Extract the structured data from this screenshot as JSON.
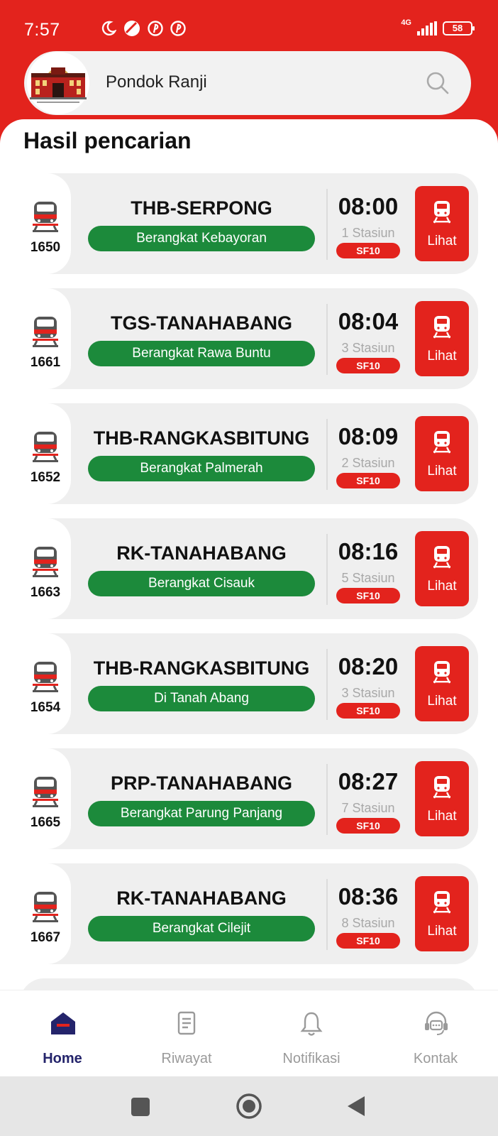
{
  "status_bar": {
    "time": "7:57",
    "network": "4G",
    "battery": "58",
    "left_icons": [
      "moon-icon",
      "ball-icon",
      "pinterest-icon",
      "pinterest-icon"
    ]
  },
  "search": {
    "value": "Pondok Ranji",
    "icon": "search-icon"
  },
  "results": {
    "title": "Hasil pencarian",
    "button_label": "Lihat",
    "items": [
      {
        "number": "1650",
        "route": "THB-SERPONG",
        "departure": "Berangkat Kebayoran",
        "time": "08:00",
        "stations": "1 Stasiun",
        "platform": "SF10"
      },
      {
        "number": "1661",
        "route": "TGS-TANAHABANG",
        "departure": "Berangkat Rawa Buntu",
        "time": "08:04",
        "stations": "3 Stasiun",
        "platform": "SF10"
      },
      {
        "number": "1652",
        "route": "THB-RANGKASBITUNG",
        "departure": "Berangkat Palmerah",
        "time": "08:09",
        "stations": "2 Stasiun",
        "platform": "SF10"
      },
      {
        "number": "1663",
        "route": "RK-TANAHABANG",
        "departure": "Berangkat Cisauk",
        "time": "08:16",
        "stations": "5 Stasiun",
        "platform": "SF10"
      },
      {
        "number": "1654",
        "route": "THB-RANGKASBITUNG",
        "departure": "Di Tanah Abang",
        "time": "08:20",
        "stations": "3 Stasiun",
        "platform": "SF10"
      },
      {
        "number": "1665",
        "route": "PRP-TANAHABANG",
        "departure": "Berangkat Parung Panjang",
        "time": "08:27",
        "stations": "7 Stasiun",
        "platform": "SF10"
      },
      {
        "number": "1667",
        "route": "RK-TANAHABANG",
        "departure": "Berangkat Cilejit",
        "time": "08:36",
        "stations": "8 Stasiun",
        "platform": "SF10"
      }
    ]
  },
  "bottom_nav": [
    {
      "label": "Home",
      "icon": "home-icon",
      "active": true
    },
    {
      "label": "Riwayat",
      "icon": "history-icon",
      "active": false
    },
    {
      "label": "Notifikasi",
      "icon": "bell-icon",
      "active": false
    },
    {
      "label": "Kontak",
      "icon": "support-icon",
      "active": false
    }
  ],
  "colors": {
    "brand_red": "#e3231d",
    "pill_green": "#1c8a3b",
    "nav_active": "#24246b",
    "nav_inactive": "#9a9a9a"
  }
}
